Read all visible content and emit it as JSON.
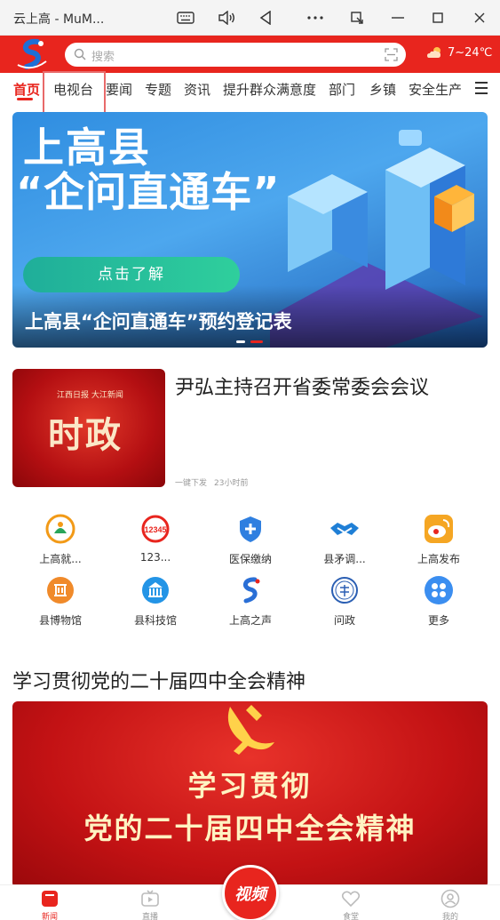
{
  "window": {
    "title": "云上高 - MuM..."
  },
  "header": {
    "search_placeholder": "搜索",
    "weather_temp": "7~24℃"
  },
  "tabs": [
    {
      "label": "首页",
      "active": true
    },
    {
      "label": "电视台"
    },
    {
      "label": "要闻"
    },
    {
      "label": "专题"
    },
    {
      "label": "资讯"
    },
    {
      "label": "提升群众满意度"
    },
    {
      "label": "部门"
    },
    {
      "label": "乡镇"
    },
    {
      "label": "安全生产"
    }
  ],
  "banner": {
    "headline_line1": "上高县",
    "headline_line2": "“企问直通车”",
    "button_label": "点击了解",
    "caption": "上高县“企问直通车”预约登记表"
  },
  "news": {
    "thumb_text": "时政",
    "thumb_small": "江西日报 大江新闻",
    "title": "尹弘主持召开省委常委会会议",
    "source": "一键下发",
    "time": "23小时前"
  },
  "services": [
    {
      "label": "上高就...",
      "icon": "employment-icon",
      "color": "#f29a17"
    },
    {
      "label": "123...",
      "icon": "hotline-12345-icon",
      "color": "#e8251e"
    },
    {
      "label": "医保缴纳",
      "icon": "medical-insurance-icon",
      "color": "#2f7fe0"
    },
    {
      "label": "县矛调...",
      "icon": "handshake-icon",
      "color": "#1f7fd6"
    },
    {
      "label": "上高发布",
      "icon": "weibo-icon",
      "color": "#f5a623"
    },
    {
      "label": "县博物馆",
      "icon": "museum-icon",
      "color": "#f08a2a"
    },
    {
      "label": "县科技馆",
      "icon": "science-museum-icon",
      "color": "#2394e6"
    },
    {
      "label": "上高之声",
      "icon": "voice-logo-icon",
      "color": "#2a6fd6"
    },
    {
      "label": "问政",
      "icon": "wenzheng-icon",
      "color": "#2b5fb3"
    },
    {
      "label": "更多",
      "icon": "more-apps-icon",
      "color": "#3b8ef0"
    }
  ],
  "section": {
    "title": "学习贯彻党的二十届四中全会精神",
    "banner_line1": "学习贯彻",
    "banner_line2": "党的二十届四中全会精神"
  },
  "bottom_nav": [
    {
      "label": "新闻",
      "active": true
    },
    {
      "label": "直播"
    },
    {
      "label": "视频"
    },
    {
      "label": "食堂"
    },
    {
      "label": "我的"
    }
  ],
  "colors": {
    "brand": "#e8251e"
  }
}
